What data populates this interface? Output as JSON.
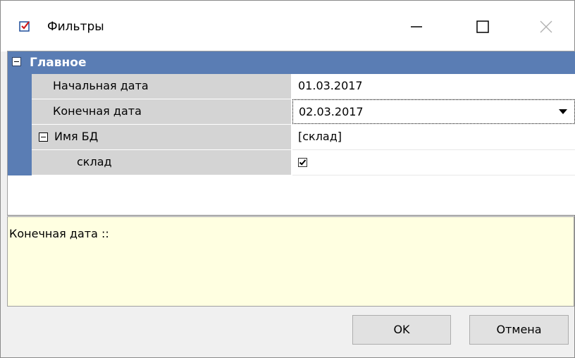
{
  "window": {
    "title": "Фильтры",
    "icon": "checkbox-list-icon",
    "controls": {
      "minimize": "minimize-icon",
      "maximize": "maximize-icon",
      "close": "close-icon"
    }
  },
  "grid": {
    "category": {
      "label": "Главное",
      "expanded": true
    },
    "rows": [
      {
        "name": "Начальная дата",
        "value": "01.03.2017"
      },
      {
        "name": "Конечная дата",
        "value": "02.03.2017",
        "editor": "dropdown"
      },
      {
        "name": "Имя БД",
        "value": "[склад]",
        "expanded": true
      },
      {
        "name": "склад",
        "checked": true
      }
    ]
  },
  "description": {
    "text": "Конечная дата ::"
  },
  "buttons": {
    "ok": "OK",
    "cancel": "Отмена"
  },
  "colors": {
    "category_bg": "#5a7db4",
    "description_bg": "#ffffe1",
    "name_cell_bg": "#d4d4d4"
  }
}
